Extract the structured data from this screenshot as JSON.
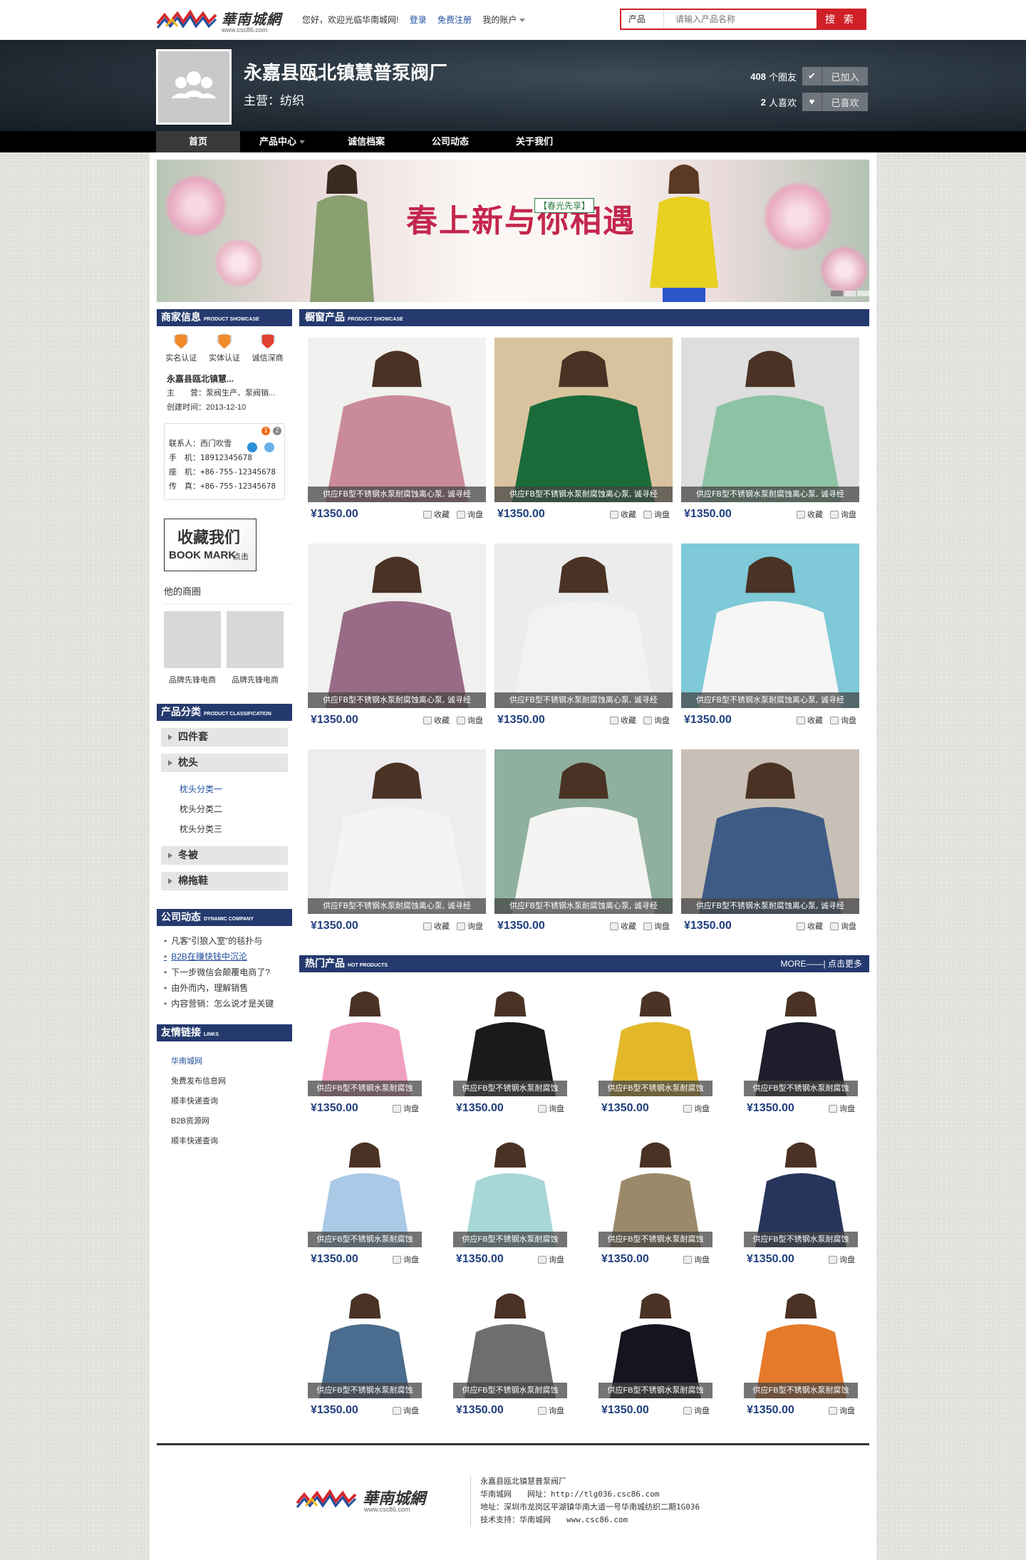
{
  "header": {
    "logo_text": "華南城網",
    "logo_url": "www.csc86.com",
    "welcome": "您好，欢迎光临华南城网!",
    "login": "登录",
    "register": "免费注册",
    "account": "我的账户",
    "search": {
      "category": "产品",
      "placeholder": "请输入产品名称",
      "button": "搜 索"
    }
  },
  "shop": {
    "name": "永嘉县瓯北镇慧普泵阀厂",
    "business": "主营：纺织",
    "friends_count": "408",
    "friends_label": "个圈友",
    "friends_btn": "已加入",
    "likes_count": "2",
    "likes_label": "人喜欢",
    "likes_btn": "已喜欢"
  },
  "nav": [
    "首页",
    "产品中心",
    "诚信档案",
    "公司动态",
    "关于我们"
  ],
  "banner": {
    "title": "春上新与你相遇",
    "badge": "【春光先享】"
  },
  "sidebar": {
    "merchant_title": "商家信息",
    "merchant_sub": "PRODUCT SHOWCASE",
    "certs": [
      "实名认证",
      "实体认证",
      "诚信深商"
    ],
    "company": "永嘉县瓯北镇慧...",
    "main_business": "主　　营：泵阀生产、泵阀销...",
    "created": "创建时间：2013-12-10",
    "contact": [
      "联系人：西门吹雪",
      "手　机：18912345678",
      "座　机：+86-755-12345678",
      "传　真：+86-755-12345678"
    ],
    "badge1": "1",
    "badge2": "2",
    "bookmark": [
      "收藏我们",
      "BOOK MARK",
      "点击"
    ],
    "circle_title": "他的商圈",
    "circles": [
      "品牌先锋电商",
      "品牌先锋电商"
    ],
    "category_title": "产品分类",
    "category_sub": "PRODUCT CLASSIFICATION",
    "categories": [
      "四件套",
      "枕头",
      "冬被",
      "棉拖鞋"
    ],
    "subcategories": [
      "枕头分类一",
      "枕头分类二",
      "枕头分类三"
    ],
    "news_title": "公司动态",
    "news_sub": "DYNAMIC COMPANY",
    "news": [
      "凡客“引狼入室”的毯扑与",
      "B2B在赚快钱中沉沦",
      "下一步微信会颠覆电商了?",
      "由外而内，理解销售",
      "内容营销：怎么说才是关键"
    ],
    "links_title": "友情链接",
    "links_sub": "LINKS",
    "links": [
      "华南城网",
      "免费发布信息网",
      "顺丰快递查询",
      "B2B资源网",
      "顺丰快递查询"
    ]
  },
  "showcase": {
    "title": "橱窗产品",
    "sub": "PRODUCT SHOWCASE",
    "caption": "供应FB型不锈钢水泵耐腐蚀离心泵, 诚寻经",
    "price": "¥1350.00",
    "fav": "收藏",
    "inquire": "询盘"
  },
  "hot": {
    "title": "热门产品",
    "sub": "HOT PRODUCTS",
    "more": "MORE——| 点击更多",
    "caption": "供应FB型不锈钢水泵耐腐蚀",
    "price": "¥1350.00",
    "inquire": "询盘"
  },
  "footer": {
    "company": "永嘉县瓯北镇慧普泵阀厂",
    "site": "华南城网　　网址：http://tlg036.csc86.com",
    "address": "地址：深圳市龙岗区平湖镇华南大道一号华南城纺织二期1G036",
    "support": "技术支持：华南城网　　www.csc86.com"
  },
  "colors": {
    "brand_red": "#cf2027",
    "navy": "#243a6e",
    "price_blue": "#1f3e7e",
    "nav_bg": "#000000"
  }
}
